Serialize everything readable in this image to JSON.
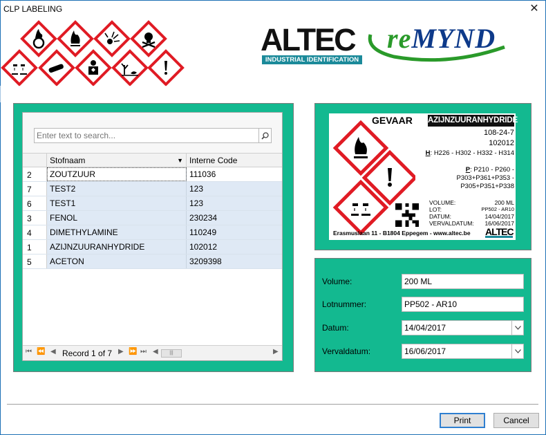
{
  "window": {
    "title": "CLP LABELING",
    "close_glyph": "✕"
  },
  "logos": {
    "altec": "ALTEC",
    "altec_tagline": "INDUSTRIAL IDENTIFICATION",
    "remynd_re": "re",
    "remynd_mynd": "MYND"
  },
  "grid": {
    "search_placeholder": "Enter text to search...",
    "columns": [
      "Stofnaam",
      "Interne Code"
    ],
    "rows": [
      {
        "num": "2",
        "name": "ZOUTZUUR",
        "code": "111036",
        "selected": true
      },
      {
        "num": "7",
        "name": "TEST2",
        "code": "123"
      },
      {
        "num": "6",
        "name": "TEST1",
        "code": "123"
      },
      {
        "num": "3",
        "name": "FENOL",
        "code": "230234"
      },
      {
        "num": "4",
        "name": "DIMETHYLAMINE",
        "code": "110249"
      },
      {
        "num": "1",
        "name": "AZIJNZUURANHYDRIDE",
        "code": "102012"
      },
      {
        "num": "5",
        "name": "ACETON",
        "code": "3209398"
      }
    ],
    "record_text": "Record 1 of 7"
  },
  "label": {
    "signal_word": "GEVAAR",
    "substance": "AZIJNZUURANHYDRIDE",
    "cas": "108-24-7",
    "code": "102012",
    "h_prefix": "H",
    "h_statements": ": H226 - H302 - H332 - H314",
    "p_prefix": "P",
    "p_line1": ": P210 - P260 -",
    "p_line2": "P303+P361+P353 -",
    "p_line3": "P305+P351+P338",
    "volume_label": "VOLUME:",
    "volume_value": "200 ML",
    "lot_label": "LOT:",
    "lot_value": "PP502 - AR10",
    "datum_label": "DATUM:",
    "datum_value": "14/04/2017",
    "verval_label": "VERVALDATUM:",
    "verval_value": "16/06/2017",
    "footer": "Erasmuslaan 11 - B1804 Eppegem - www.altec.be",
    "brand": "ALTEC"
  },
  "form": {
    "volume_label": "Volume:",
    "volume_value": "200 ML",
    "lot_label": "Lotnummer:",
    "lot_value": "PP502 - AR10",
    "datum_label": "Datum:",
    "datum_value": "14/04/2017",
    "verval_label": "Vervaldatum:",
    "verval_value": "16/06/2017"
  },
  "buttons": {
    "print": "Print",
    "cancel": "Cancel"
  },
  "colors": {
    "panel": "#13b990",
    "ghs_red": "#e01b24",
    "altec_teal": "#1b8a9a"
  }
}
